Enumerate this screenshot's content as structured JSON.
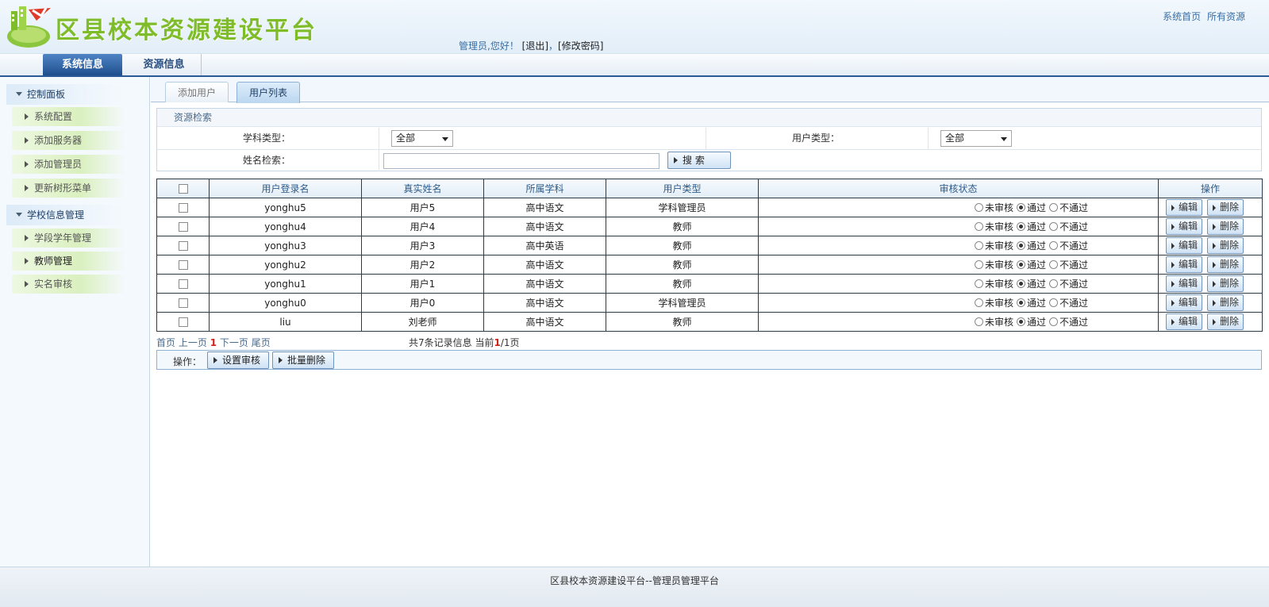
{
  "header": {
    "site_title": "区县校本资源建设平台",
    "welcome_prefix": "管理员,您好！",
    "logout": "[退出]",
    "separator": "，",
    "change_password": "[修改密码]",
    "top_links": [
      "系统首页",
      "所有资源"
    ]
  },
  "nav": {
    "tabs": [
      {
        "label": "系统信息",
        "active": true
      },
      {
        "label": "资源信息",
        "active": false
      }
    ]
  },
  "sidebar": {
    "groups": [
      {
        "label": "控制面板",
        "items": [
          "系统配置",
          "添加服务器",
          "添加管理员",
          "更新树形菜单"
        ]
      },
      {
        "label": "学校信息管理",
        "items": [
          "学段学年管理",
          "教师管理",
          "实名审核"
        ]
      }
    ]
  },
  "tabs": {
    "add_user": "添加用户",
    "user_list": "用户列表"
  },
  "search": {
    "title": "资源检索",
    "subject_label": "学科类型：",
    "subject_value": "全部",
    "user_type_label": "用户类型：",
    "user_type_value": "全部",
    "name_label": "姓名检索：",
    "name_value": "",
    "search_button": "搜 索"
  },
  "table": {
    "headers": [
      "用户登录名",
      "真实姓名",
      "所属学科",
      "用户类型",
      "审核状态",
      "操作"
    ],
    "status_options": [
      "未审核",
      "通过",
      "不通过"
    ],
    "edit_label": "编辑",
    "delete_label": "删除",
    "rows": [
      {
        "login": "yonghu5",
        "name": "用户5",
        "subject": "高中语文",
        "type": "学科管理员",
        "status": "通过"
      },
      {
        "login": "yonghu4",
        "name": "用户4",
        "subject": "高中语文",
        "type": "教师",
        "status": "通过"
      },
      {
        "login": "yonghu3",
        "name": "用户3",
        "subject": "高中英语",
        "type": "教师",
        "status": "通过"
      },
      {
        "login": "yonghu2",
        "name": "用户2",
        "subject": "高中语文",
        "type": "教师",
        "status": "通过"
      },
      {
        "login": "yonghu1",
        "name": "用户1",
        "subject": "高中语文",
        "type": "教师",
        "status": "通过"
      },
      {
        "login": "yonghu0",
        "name": "用户0",
        "subject": "高中语文",
        "type": "学科管理员",
        "status": "通过"
      },
      {
        "login": "liu",
        "name": "刘老师",
        "subject": "高中语文",
        "type": "教师",
        "status": "通过"
      }
    ]
  },
  "pager": {
    "first": "首页",
    "prev": "上一页",
    "current": "1",
    "next": "下一页",
    "last": "尾页",
    "total_prefix": "共",
    "total": "7",
    "total_suffix": "条记录信息 当前",
    "page": "1",
    "pages": "/1页"
  },
  "ops": {
    "label": "操作：",
    "set_review": "设置审核",
    "batch_delete": "批量删除"
  },
  "footer": {
    "text": "区县校本资源建设平台--管理员管理平台"
  },
  "colors": {
    "title_green": "#7ebc2a",
    "nav_blue": "#1f4f8e",
    "link_blue": "#3a6ea5",
    "page_red": "#d0241b"
  }
}
